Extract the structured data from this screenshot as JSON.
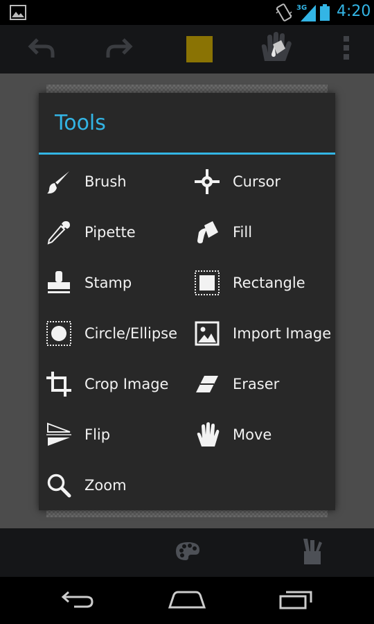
{
  "status_bar": {
    "time": "4:20",
    "network_type": "3G",
    "icons": [
      "gallery-icon",
      "vibrate-icon",
      "signal-icon",
      "battery-icon"
    ],
    "clock_color": "#33b5e5"
  },
  "action_bar": {
    "buttons": [
      "undo-icon",
      "redo-icon",
      "color-swatch",
      "tool-fill-icon",
      "overflow-menu-icon"
    ],
    "current_color": "#8a7304"
  },
  "dialog": {
    "title": "Tools",
    "accent_color": "#33b5e5",
    "tools": [
      {
        "label": "Brush",
        "icon": "brush-icon"
      },
      {
        "label": "Cursor",
        "icon": "cursor-icon"
      },
      {
        "label": "Pipette",
        "icon": "pipette-icon"
      },
      {
        "label": "Fill",
        "icon": "fill-icon"
      },
      {
        "label": "Stamp",
        "icon": "stamp-icon"
      },
      {
        "label": "Rectangle",
        "icon": "rectangle-icon"
      },
      {
        "label": "Circle/Ellipse",
        "icon": "circle-ellipse-icon"
      },
      {
        "label": "Import Image",
        "icon": "import-image-icon"
      },
      {
        "label": "Crop Image",
        "icon": "crop-icon"
      },
      {
        "label": "Eraser",
        "icon": "eraser-icon"
      },
      {
        "label": "Flip",
        "icon": "flip-icon"
      },
      {
        "label": "Move",
        "icon": "move-icon"
      },
      {
        "label": "Zoom",
        "icon": "zoom-icon"
      }
    ]
  },
  "bottom_bar": {
    "buttons": [
      "palette-icon",
      "tools-icon"
    ]
  },
  "nav_bar": {
    "buttons": [
      "back-icon",
      "home-icon",
      "recent-apps-icon"
    ]
  }
}
